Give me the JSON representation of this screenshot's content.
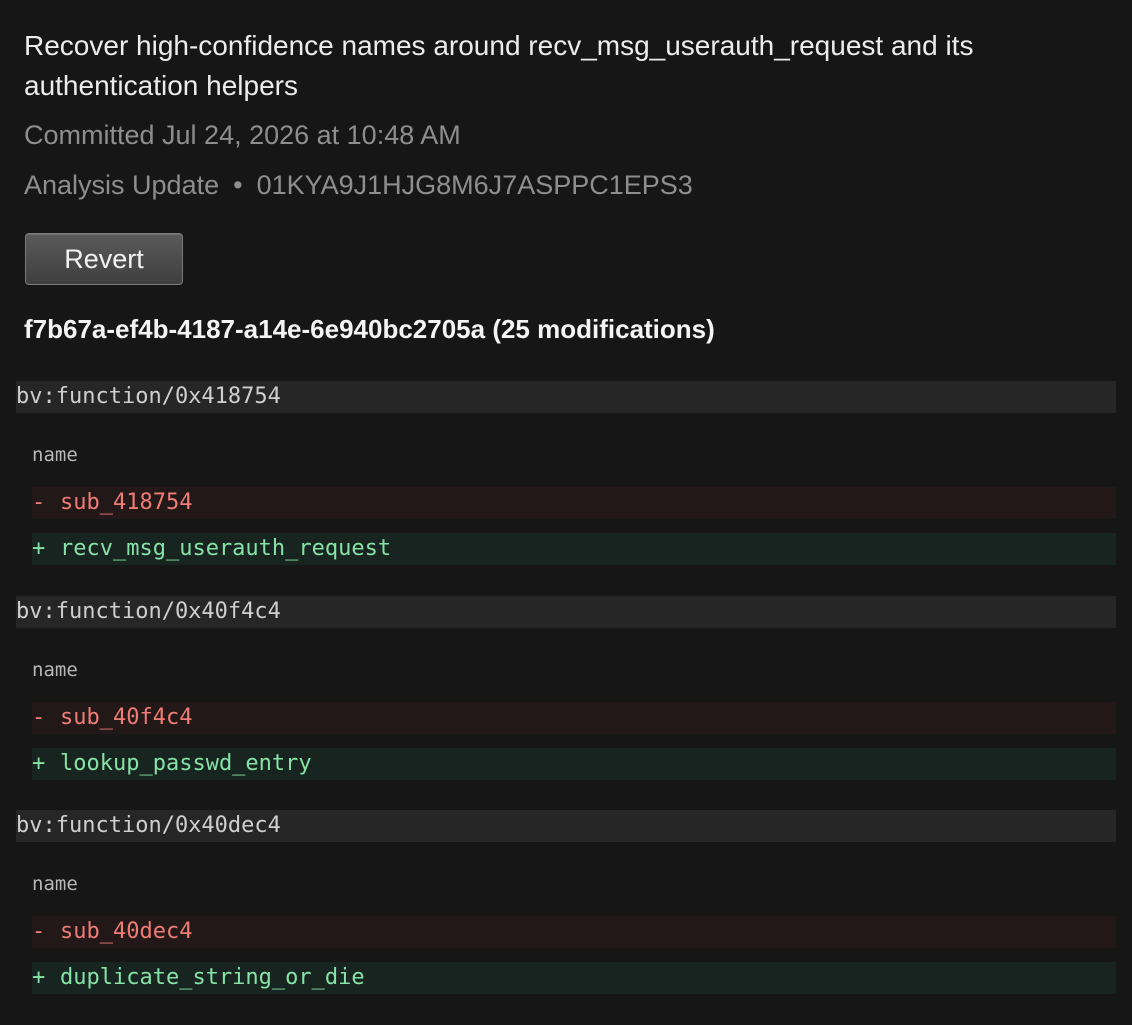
{
  "commit": {
    "title": "Recover high-confidence names around recv_msg_userauth_request and its authentication helpers",
    "committed": "Committed Jul 24, 2026 at 10:48 AM",
    "type": "Analysis Update",
    "separator": "•",
    "id": "01KYA9J1HJG8M6J7ASPPC1EPS3",
    "revert_label": "Revert",
    "target_summary": "f7b67a-ef4b-4187-a14e-6e940bc2705a (25 modifications)"
  },
  "modifications": [
    {
      "path": "bv:function/0x418754",
      "field": "name",
      "removed_sign": "-",
      "removed": "sub_418754",
      "added_sign": "+",
      "added": "recv_msg_userauth_request"
    },
    {
      "path": "bv:function/0x40f4c4",
      "field": "name",
      "removed_sign": "-",
      "removed": "sub_40f4c4",
      "added_sign": "+",
      "added": "lookup_passwd_entry"
    },
    {
      "path": "bv:function/0x40dec4",
      "field": "name",
      "removed_sign": "-",
      "removed": "sub_40dec4",
      "added_sign": "+",
      "added": "duplicate_string_or_die"
    }
  ],
  "colors": {
    "background": "#161616",
    "removed_text": "#f07c76",
    "added_text": "#86e2a6",
    "removed_bg": "#221818",
    "added_bg": "#172420"
  }
}
